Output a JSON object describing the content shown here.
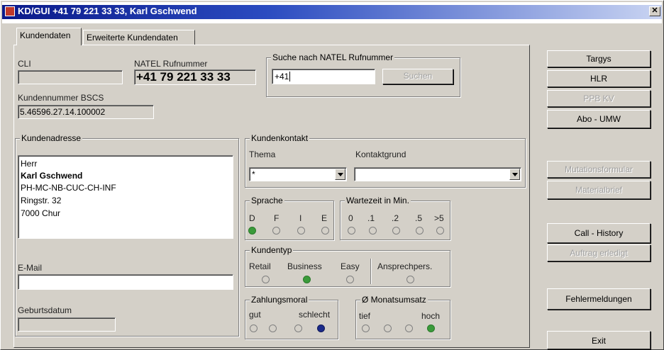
{
  "window": {
    "title": "KD/GUI    +41 79 221 33 33, Karl Gschwend",
    "close_glyph": "✕"
  },
  "tabs": [
    {
      "label": "Kundendaten",
      "active": true
    },
    {
      "label": "Erweiterte Kundendaten",
      "active": false
    }
  ],
  "cli": {
    "label": "CLI",
    "value": ""
  },
  "natel": {
    "label": "NATEL Rufnummer",
    "value": "+41 79 221 33 33"
  },
  "search": {
    "group_title": "Suche nach NATEL Rufnummer",
    "prefix": "+41",
    "value": "",
    "button": "Suchen"
  },
  "bscs": {
    "label": "Kundennummer BSCS",
    "value": "5.46596.27.14.100002"
  },
  "address": {
    "group_title": "Kundenadresse",
    "lines": [
      "Herr",
      "Karl Gschwend",
      "PH-MC-NB-CUC-CH-INF",
      "Ringstr. 32",
      "7000 Chur"
    ]
  },
  "email": {
    "label": "E-Mail",
    "value": ""
  },
  "birthdate": {
    "label": "Geburtsdatum",
    "value": ""
  },
  "kundenkontakt": {
    "group_title": "Kundenkontakt",
    "thema_label": "Thema",
    "thema_value": "*",
    "grund_label": "Kontaktgrund",
    "grund_value": ""
  },
  "sprache": {
    "group_title": "Sprache",
    "options": [
      "D",
      "F",
      "I",
      "E"
    ],
    "selected": "D"
  },
  "wartezeit": {
    "group_title": "Wartezeit in Min.",
    "options": [
      "0",
      ".1",
      ".2",
      ".5",
      ">5"
    ],
    "selected": ""
  },
  "kundentyp": {
    "group_title": "Kundentyp",
    "options": [
      "Retail",
      "Business",
      "Easy"
    ],
    "selected": "Business",
    "ansprech_label": "Ansprechpers."
  },
  "zahlungsmoral": {
    "group_title": "Zahlungsmoral",
    "low_label": "gut",
    "high_label": "schlecht",
    "selected_index": 3
  },
  "monatsumsatz": {
    "group_title": "Ø Monatsumsatz",
    "low_label": "tief",
    "high_label": "hoch",
    "selected_index": 3
  },
  "side_buttons": {
    "targys": "Targys",
    "hlr": "HLR",
    "ppb": "PPB KV",
    "abo": "Abo - UMW",
    "mutation": "Mutationsformular",
    "material": "Materialbrief",
    "call_history": "Call - History",
    "auftrag": "Auftrag erledigt",
    "fehler": "Fehlermeldungen",
    "exit": "Exit"
  },
  "colors": {
    "selected_green": "#3a9a3a",
    "selected_blue": "#1a2a8a",
    "title_bar": "#0b1a8a"
  }
}
